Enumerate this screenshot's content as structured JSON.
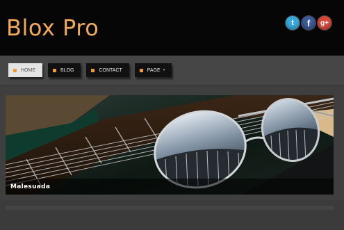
{
  "site": {
    "title": "Blox Pro"
  },
  "social": [
    {
      "name": "twitter",
      "glyph": "t"
    },
    {
      "name": "facebook",
      "glyph": "f"
    },
    {
      "name": "google-plus",
      "glyph": "g+"
    }
  ],
  "nav": {
    "items": [
      {
        "label": "HOME",
        "active": true
      },
      {
        "label": "BLOG"
      },
      {
        "label": "CONTACT"
      },
      {
        "label": "PAGE",
        "caret": "▾"
      }
    ]
  },
  "slider": {
    "caption": "Malesuada"
  },
  "colors": {
    "accent": "#f29b2e",
    "title": "#f0a95b",
    "header_bg": "#060606",
    "body_bg": "#3f3f3f"
  }
}
